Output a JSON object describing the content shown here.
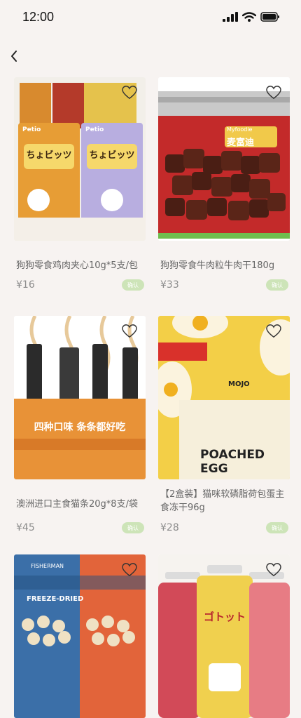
{
  "status_bar": {
    "time": "12:00"
  },
  "products": [
    {
      "title": "狗狗零食鸡肉夹心10g*5支/包",
      "price": "¥16",
      "confirm_label": "确认",
      "image_text": "ちょビッツ",
      "brand_text": "Petio"
    },
    {
      "title": "狗狗零食牛肉粒牛肉干180g",
      "price": "¥33",
      "confirm_label": "确认",
      "image_text": "麦富迪",
      "brand_text": "Myfoodie"
    },
    {
      "title": "澳洲进口主食猫条20g*8支/袋",
      "price": "¥45",
      "confirm_label": "确认",
      "image_text": "四种口味 条条都好吃"
    },
    {
      "title": "【2盒装】猫咪软磷脂荷包蛋主食冻干96g",
      "price": "¥28",
      "confirm_label": "确认",
      "image_text": "POACHED EGG",
      "brand_text": "MOJO"
    },
    {
      "title": "",
      "price": "",
      "confirm_label": "",
      "image_text": "FREEZE-DRIED",
      "brand_text": "FISHERMAN"
    },
    {
      "title": "",
      "price": "",
      "confirm_label": "",
      "image_text": "ゴトット"
    }
  ],
  "colors": {
    "background": "#f7f3f1",
    "confirm_badge": "#cde4b8",
    "price_text": "#8c8c8c"
  },
  "icons": {
    "back": "chevron-left-icon",
    "favorite": "heart-outline-icon"
  }
}
